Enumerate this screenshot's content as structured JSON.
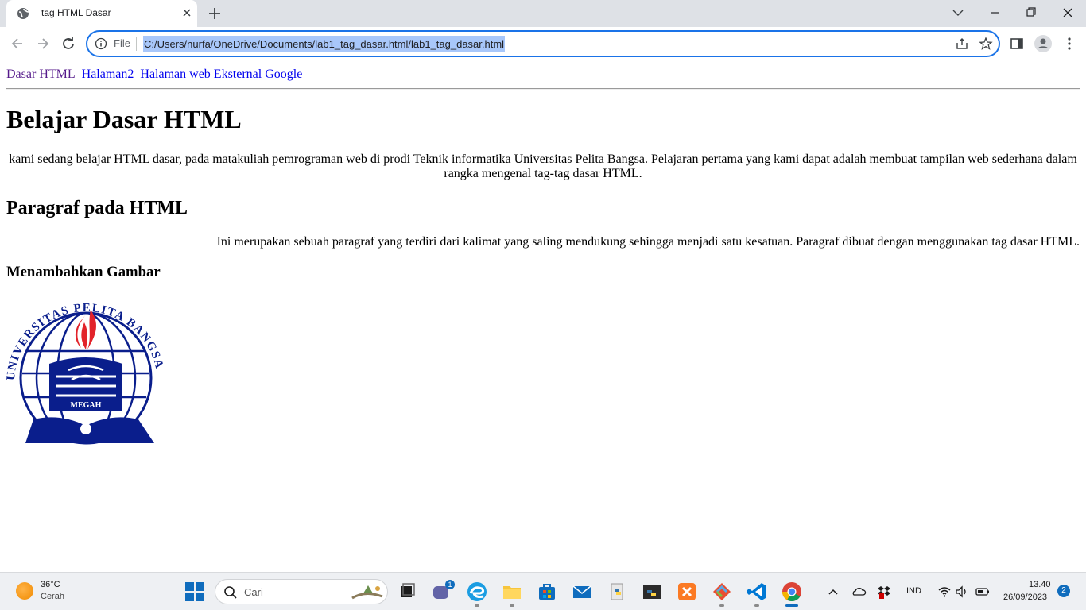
{
  "browser": {
    "tab": {
      "title": "tag HTML Dasar"
    },
    "omnibox": {
      "scheme_label": "File",
      "url": "C:/Users/nurfa/OneDrive/Documents/lab1_tag_dasar.html/lab1_tag_dasar.html"
    },
    "accent_color": "#1a73e8",
    "selection_color": "#a8c7fa"
  },
  "page": {
    "nav_links": [
      {
        "label": "Dasar HTML",
        "visited": true
      },
      {
        "label": "Halaman2",
        "visited": false
      },
      {
        "label": "Halaman web Eksternal Google",
        "visited": false
      }
    ],
    "heading1": "Belajar Dasar HTML",
    "paragraph1": "kami sedang belajar HTML dasar, pada matakuliah pemrograman web di prodi Teknik informatika Universitas Pelita Bangsa. Pelajaran pertama yang kami dapat adalah membuat tampilan web sederhana dalam rangka mengenal tag-tag dasar HTML.",
    "heading2": "Paragraf pada HTML",
    "paragraph2": "Ini merupakan sebuah paragraf yang terdiri dari kalimat yang saling mendukung sehingga menjadi satu kesatuan. Paragraf dibuat dengan menggunakan tag dasar HTML.",
    "heading3": "Menambahkan Gambar",
    "logo": {
      "arc_text": "UNIVERSITAS PELITA BANGSA",
      "book_text": "MEGAH",
      "color": "#0a1e8c",
      "flame_color": "#e2232a"
    }
  },
  "taskbar": {
    "weather": {
      "temp": "36°C",
      "condition": "Cerah"
    },
    "search_placeholder": "Cari",
    "teams_badge": "1",
    "tray_language": "IND",
    "clock": {
      "time": "13.40",
      "date": "26/09/2023"
    },
    "notification_count": "2"
  }
}
